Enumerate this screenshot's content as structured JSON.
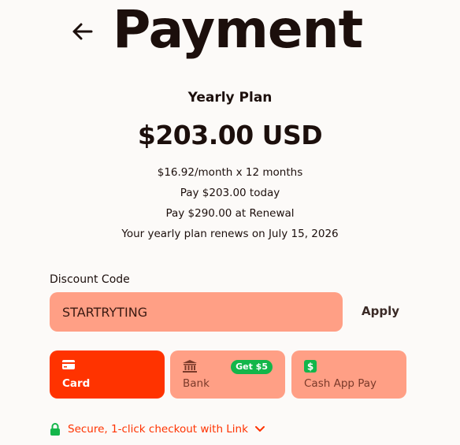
{
  "header": {
    "title": "Payment",
    "back_icon": "arrow-left-icon"
  },
  "plan": {
    "name": "Yearly Plan",
    "price": "$203.00 USD",
    "monthly": "$16.92/month x 12 months",
    "today": "Pay $203.00 today",
    "renewal": "Pay $290.00 at Renewal",
    "renews_on": "Your yearly plan renews on July 15, 2026"
  },
  "discount": {
    "label": "Discount Code",
    "value": "STARTRYTING",
    "apply_label": "Apply"
  },
  "payment_methods": [
    {
      "label": "Card",
      "icon": "credit-card-icon",
      "selected": true
    },
    {
      "label": "Bank",
      "icon": "bank-icon",
      "badge": "Get $5",
      "selected": false
    },
    {
      "label": "Cash App Pay",
      "icon": "cash-app-icon",
      "selected": false
    }
  ],
  "link": {
    "text": "Secure, 1-click checkout with Link",
    "icon": "lock-icon"
  },
  "colors": {
    "accent": "#ff3300",
    "input_bg": "#ff9f85",
    "badge": "#13b64a",
    "text": "#1c0f0c"
  }
}
